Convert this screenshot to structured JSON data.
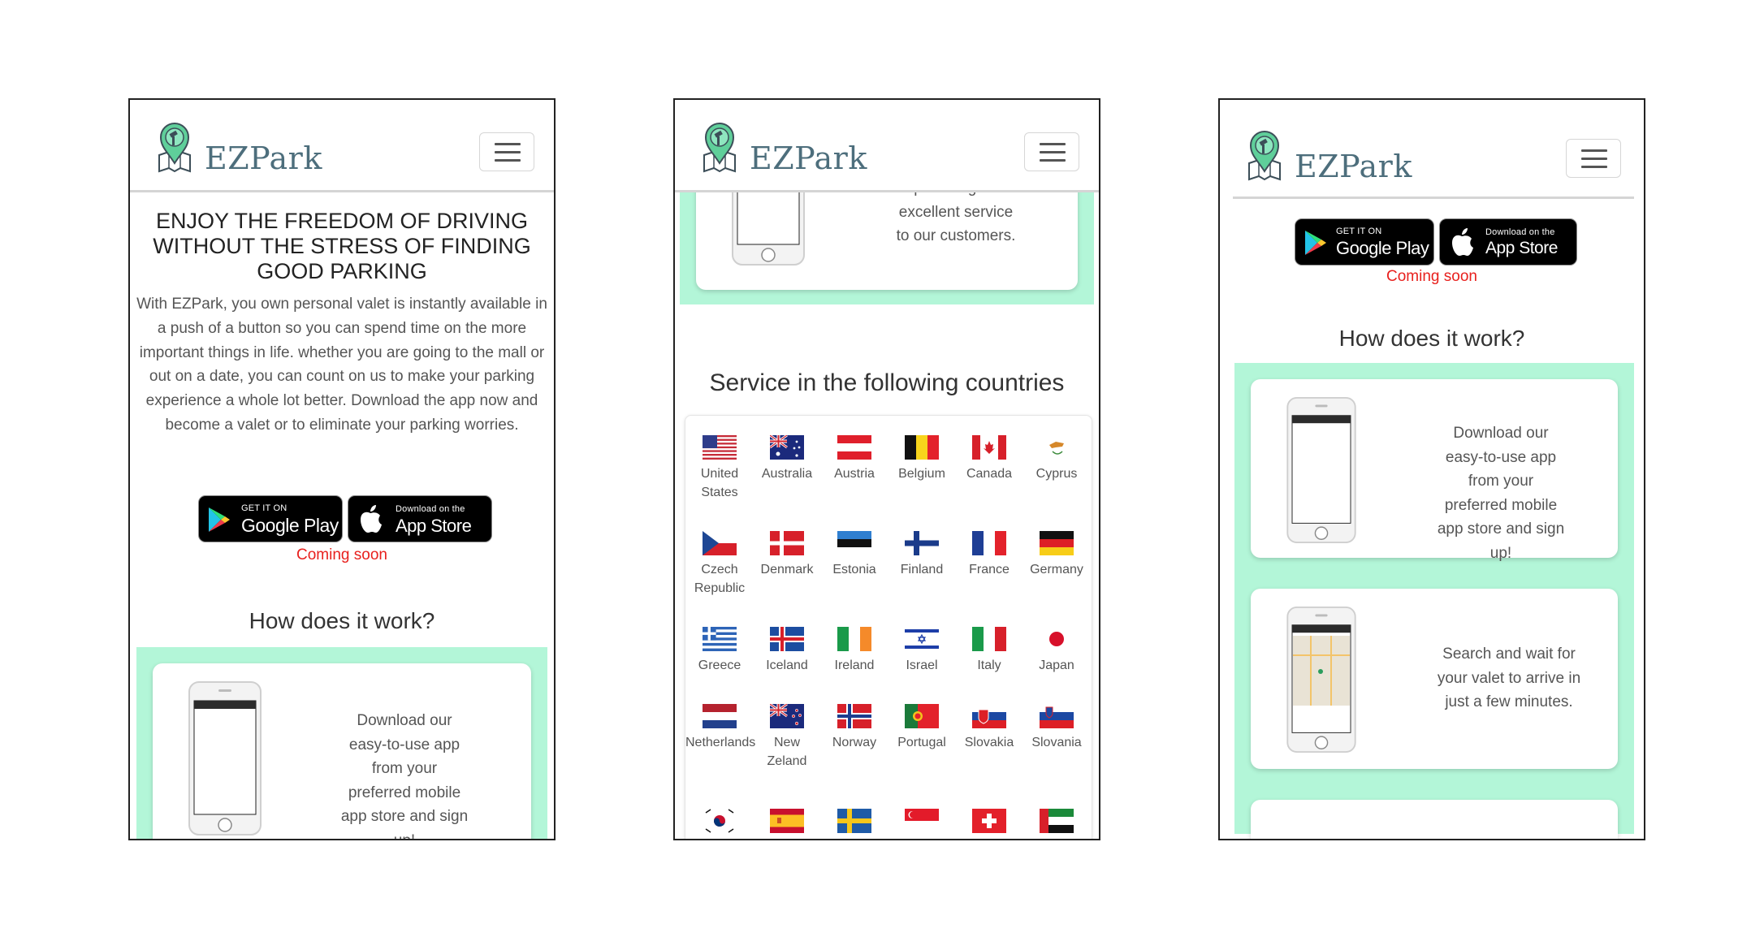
{
  "brand": {
    "name": "EZPark"
  },
  "hero": {
    "title": "ENJOY THE FREEDOM OF DRIVING WITHOUT THE STRESS OF FINDING GOOD PARKING",
    "description": "With EZPark, you own personal valet is instantly available in a push of a button so you can spend time on the more important things in life. whether you are going to the mall or out on a date, you can count on us to make your parking experience a whole lot better. Download the app now and become a valet or to eliminate your parking worries."
  },
  "stores": {
    "google_small": "GET IT ON",
    "google_large": "Google Play",
    "apple_small": "Download on the",
    "apple_large": "App Store",
    "coming_soon": "Coming soon"
  },
  "how": {
    "title": "How does it work?",
    "steps": [
      {
        "text": "Download our easy-to-use app from your preferred mobile app store and sign up!"
      },
      {
        "text": "Search and wait for your valet to arrive in just a few minutes."
      }
    ],
    "partial_text": "providing an excellent service to our customers."
  },
  "countries": {
    "title": "Service in the following countries",
    "items": [
      {
        "name": "United States"
      },
      {
        "name": "Australia"
      },
      {
        "name": "Austria"
      },
      {
        "name": "Belgium"
      },
      {
        "name": "Canada"
      },
      {
        "name": "Cyprus"
      },
      {
        "name": "Czech Republic"
      },
      {
        "name": "Denmark"
      },
      {
        "name": "Estonia"
      },
      {
        "name": "Finland"
      },
      {
        "name": "France"
      },
      {
        "name": "Germany"
      },
      {
        "name": "Greece"
      },
      {
        "name": "Iceland"
      },
      {
        "name": "Ireland"
      },
      {
        "name": "Israel"
      },
      {
        "name": "Italy"
      },
      {
        "name": "Japan"
      },
      {
        "name": "Netherlands"
      },
      {
        "name": "New Zeland"
      },
      {
        "name": "Norway"
      },
      {
        "name": "Portugal"
      },
      {
        "name": "Slovakia"
      },
      {
        "name": "Slovania"
      }
    ]
  },
  "colors": {
    "brand": "#4d6e7c",
    "mint": "#b3f6d8",
    "coming_soon": "#e8201d"
  }
}
